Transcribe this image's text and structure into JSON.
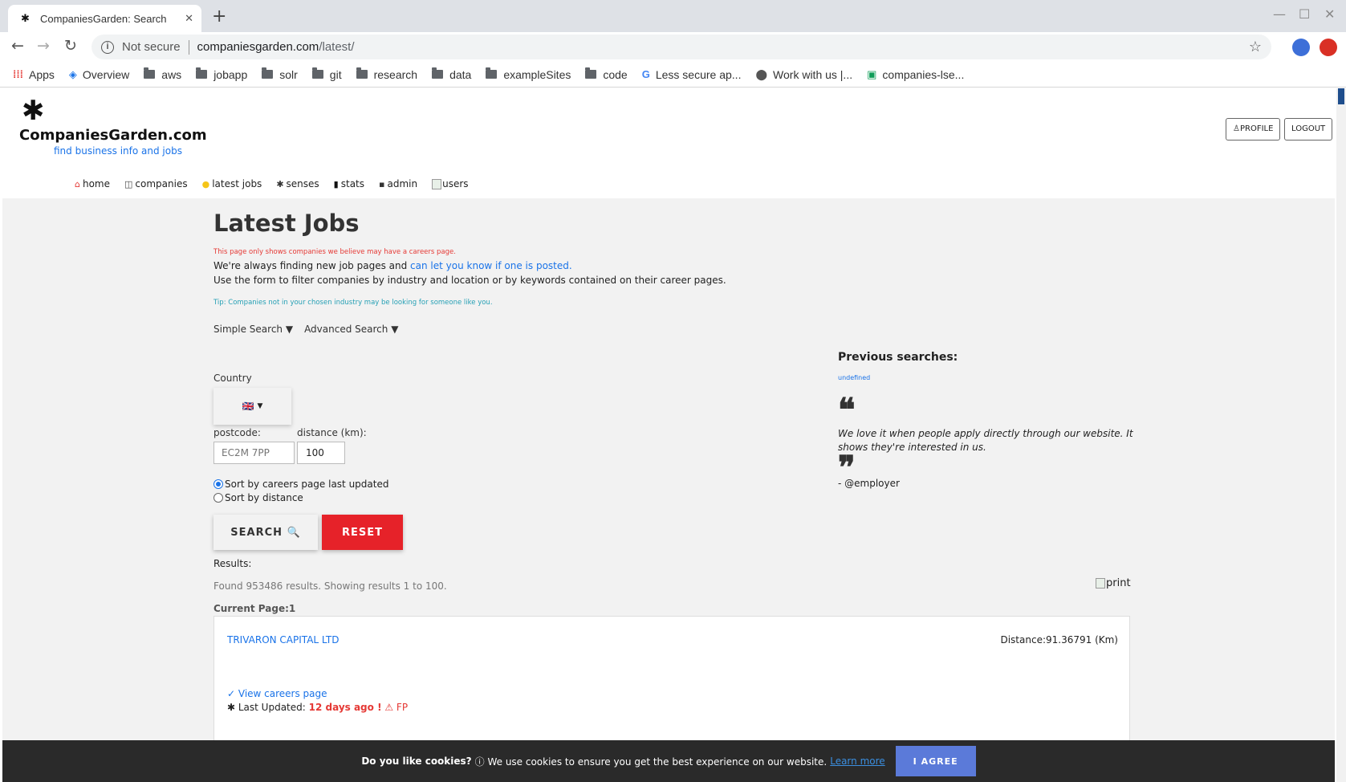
{
  "browser": {
    "tab_title": "CompaniesGarden: Search",
    "new_tab": "+",
    "not_secure": "Not secure",
    "url_host": "companiesgarden.com",
    "url_path": "/latest/",
    "bookmarks": [
      {
        "label": "Apps",
        "icon": "apps-grid-icon"
      },
      {
        "label": "Overview",
        "icon": "overview-icon"
      },
      {
        "label": "aws",
        "icon": "folder-icon"
      },
      {
        "label": "jobapp",
        "icon": "folder-icon"
      },
      {
        "label": "solr",
        "icon": "folder-icon"
      },
      {
        "label": "git",
        "icon": "folder-icon"
      },
      {
        "label": "research",
        "icon": "folder-icon"
      },
      {
        "label": "data",
        "icon": "folder-icon"
      },
      {
        "label": "exampleSites",
        "icon": "folder-icon"
      },
      {
        "label": "code",
        "icon": "folder-icon"
      },
      {
        "label": "Less secure ap...",
        "icon": "google-icon"
      },
      {
        "label": "Work with us |...",
        "icon": "database-icon"
      },
      {
        "label": "companies-lse...",
        "icon": "sheets-icon"
      }
    ]
  },
  "site": {
    "name": "CompaniesGarden.com",
    "tagline": "find business info and jobs",
    "profile_btn": "PROFILE",
    "logout_btn": "LOGOUT",
    "nav": [
      {
        "label": "home",
        "icon": "home-icon",
        "glyph": "⌂",
        "color": "#e53935"
      },
      {
        "label": "companies",
        "icon": "book-icon",
        "glyph": "▯",
        "color": "#444"
      },
      {
        "label": "latest jobs",
        "icon": "bell-icon",
        "glyph": "●",
        "color": "#f5c518"
      },
      {
        "label": "senses",
        "icon": "spider-icon",
        "glyph": "✱",
        "color": "#333"
      },
      {
        "label": "stats",
        "icon": "bar-chart-icon",
        "glyph": "▮",
        "color": "#111"
      },
      {
        "label": "admin",
        "icon": "lock-icon",
        "glyph": "▪",
        "color": "#333"
      },
      {
        "label": "users",
        "icon": "broken-image-icon",
        "glyph": "",
        "color": "#333"
      }
    ]
  },
  "main": {
    "title": "Latest Jobs",
    "warning": "This page only shows companies we believe may have a careers page.",
    "intro1_pre": "We're always finding new job pages and ",
    "intro1_link": "can let you know if one is posted.",
    "intro2": "Use the form to filter companies by industry and location or by keywords contained on their career pages.",
    "tip": "Tip: Companies not in your chosen industry may be looking for someone like you.",
    "simple_search": "Simple Search ▼",
    "advanced_search": "Advanced Search ▼",
    "country_label": "Country",
    "country_value": "🇬🇧",
    "postcode_label": "postcode:",
    "distance_label": "distance (km):",
    "postcode_placeholder": "EC2M 7PP",
    "distance_value": "100",
    "sort_updated": "Sort by careers page last updated",
    "sort_distance": "Sort by distance",
    "search_btn": "SEARCH 🔍",
    "reset_btn": "RESET",
    "results_label": "Results:",
    "found_text": "Found 953486 results. Showing results 1 to 100.",
    "print_label": "print",
    "current_page": "Current Page:1"
  },
  "result": {
    "company": "TRIVARON CAPITAL LTD",
    "distance": "Distance:91.36791 (Km)",
    "view_careers": "✓ View careers page",
    "last_updated_label": "✱ Last Updated: ",
    "last_updated_value": "12 days ago !",
    "fp": " ⚠ FP"
  },
  "sidebar": {
    "previous_title": "Previous searches:",
    "previous_item": "undefined",
    "quote_open": "❝",
    "quote_text": "We love it when people apply directly through our website. It shows they're interested in us.",
    "quote_close": "❞",
    "quote_author": "- @employer"
  },
  "cookie": {
    "question": "Do you like cookies?",
    "message": "ⓘ We use cookies to ensure you get the best experience on our website.",
    "learn_more": "Learn more",
    "agree": "I AGREE"
  }
}
